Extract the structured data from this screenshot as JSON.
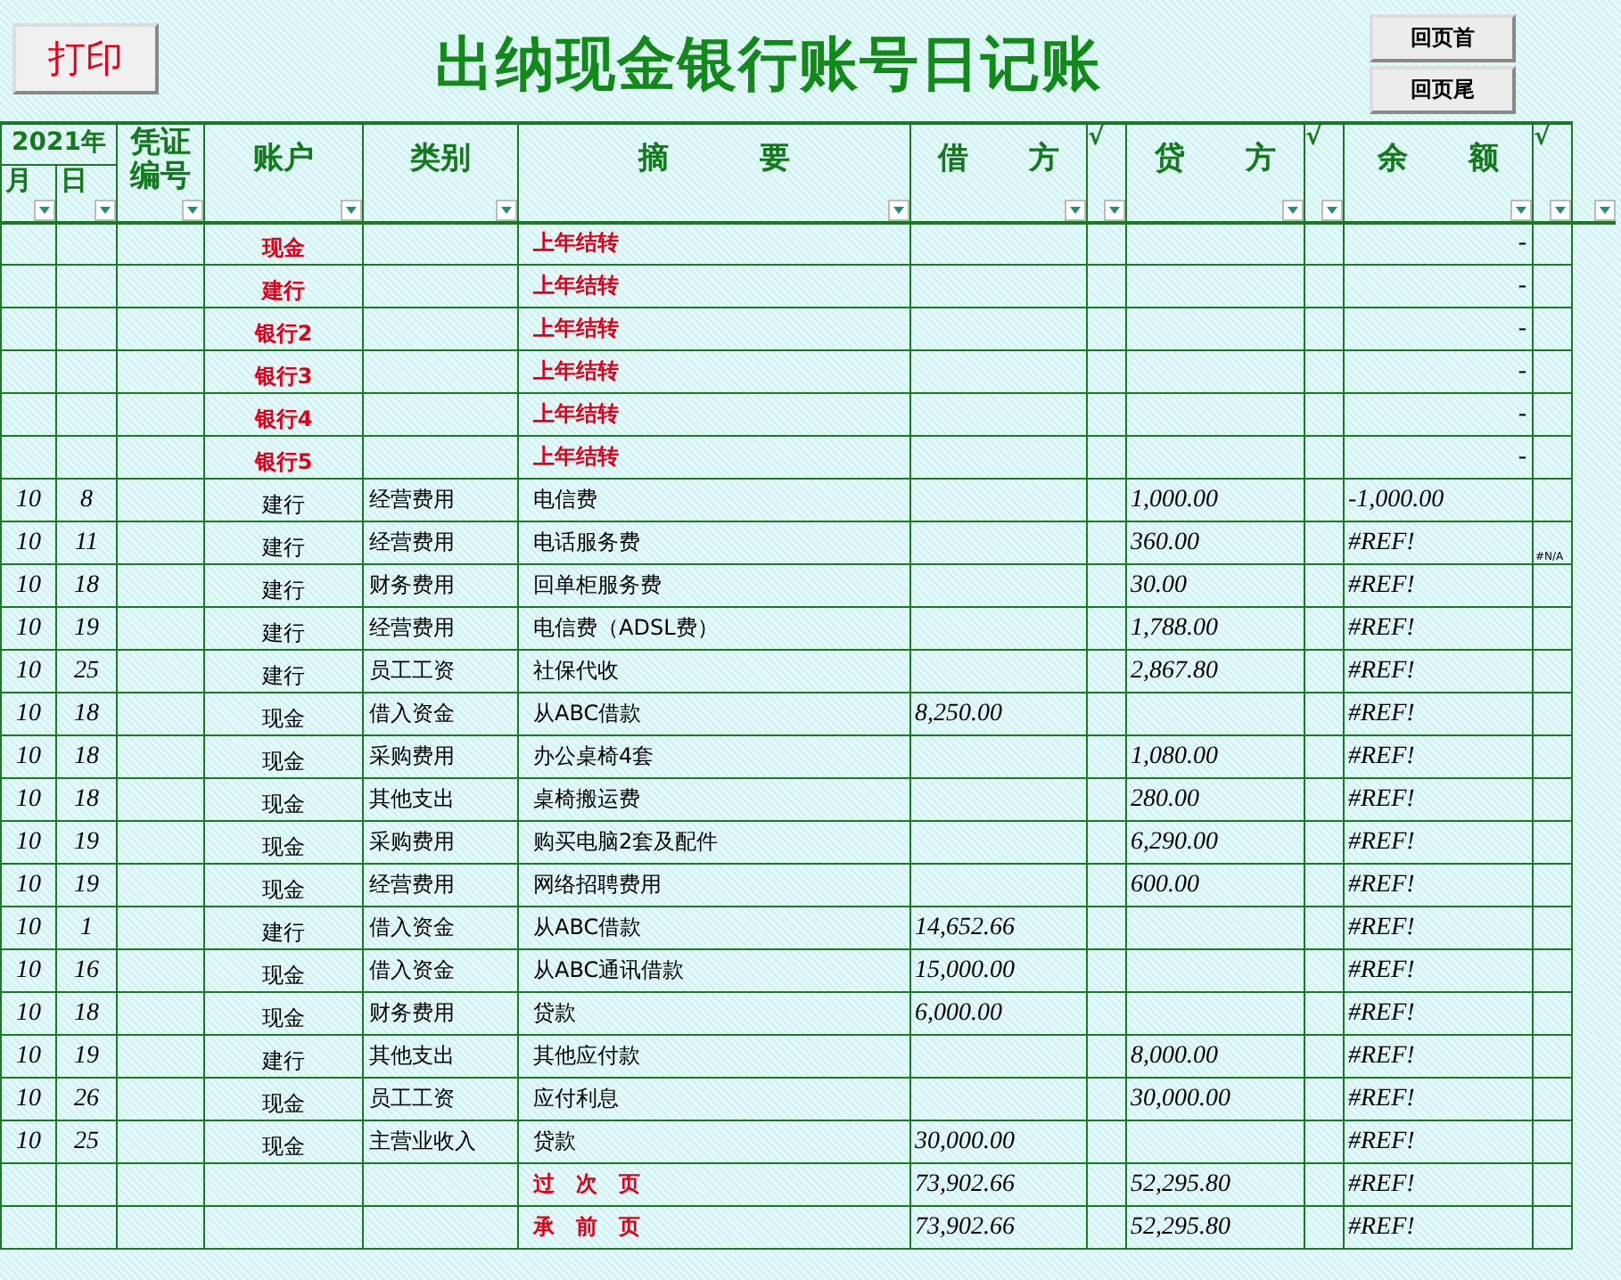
{
  "print_button": "打印",
  "title": "出纳现金银行账号日记账",
  "nav_buttons": [
    "回页首",
    "回页尾"
  ],
  "year_header": "2021年",
  "columns": [
    {
      "label": "月"
    },
    {
      "label": "日"
    },
    {
      "label": "凭证编号"
    },
    {
      "label": "账户"
    },
    {
      "label": "类别"
    },
    {
      "label": "摘　　　要"
    },
    {
      "label": "借　　方"
    },
    {
      "label": "√"
    },
    {
      "label": "贷　　方"
    },
    {
      "label": "√"
    },
    {
      "label": "余　　额"
    },
    {
      "label": "√"
    }
  ],
  "rows": [
    {
      "kind": "opening",
      "account": "现金",
      "summary": "上年结转",
      "balance": "-"
    },
    {
      "kind": "opening",
      "account": "建行",
      "summary": "上年结转",
      "balance": "-"
    },
    {
      "kind": "opening",
      "account": "银行2",
      "summary": "上年结转",
      "balance": "-"
    },
    {
      "kind": "opening",
      "account": "银行3",
      "summary": "上年结转",
      "balance": "-"
    },
    {
      "kind": "opening",
      "account": "银行4",
      "summary": "上年结转",
      "balance": "-"
    },
    {
      "kind": "opening",
      "account": "银行5",
      "summary": "上年结转",
      "balance": "-"
    },
    {
      "kind": "entry",
      "month": "10",
      "day": "8",
      "account": "建行",
      "category": "经营费用",
      "summary": "电信费",
      "credit": "1,000.00",
      "balance": "-1,000.00"
    },
    {
      "kind": "entry",
      "month": "10",
      "day": "11",
      "account": "建行",
      "category": "经营费用",
      "summary": "电话服务费",
      "credit": "360.00",
      "balance": "#REF!",
      "note": "#N/A"
    },
    {
      "kind": "entry",
      "month": "10",
      "day": "18",
      "account": "建行",
      "category": "财务费用",
      "summary": "回单柜服务费",
      "credit": "30.00",
      "balance": "#REF!"
    },
    {
      "kind": "entry",
      "month": "10",
      "day": "19",
      "account": "建行",
      "category": "经营费用",
      "summary": "电信费（ADSL费）",
      "credit": "1,788.00",
      "balance": "#REF!"
    },
    {
      "kind": "entry",
      "month": "10",
      "day": "25",
      "account": "建行",
      "category": "员工工资",
      "summary": "社保代收",
      "credit": "2,867.80",
      "balance": "#REF!"
    },
    {
      "kind": "entry",
      "month": "10",
      "day": "18",
      "account": "现金",
      "category": "借入资金",
      "summary": "从ABC借款",
      "debit": "8,250.00",
      "balance": "#REF!"
    },
    {
      "kind": "entry",
      "month": "10",
      "day": "18",
      "account": "现金",
      "category": "采购费用",
      "summary": "办公桌椅4套",
      "credit": "1,080.00",
      "balance": "#REF!"
    },
    {
      "kind": "entry",
      "month": "10",
      "day": "18",
      "account": "现金",
      "category": "其他支出",
      "summary": "桌椅搬运费",
      "credit": "280.00",
      "balance": "#REF!"
    },
    {
      "kind": "entry",
      "month": "10",
      "day": "19",
      "account": "现金",
      "category": "采购费用",
      "summary": "购买电脑2套及配件",
      "credit": "6,290.00",
      "balance": "#REF!"
    },
    {
      "kind": "entry",
      "month": "10",
      "day": "19",
      "account": "现金",
      "category": "经营费用",
      "summary": "网络招聘费用",
      "credit": "600.00",
      "balance": "#REF!"
    },
    {
      "kind": "entry",
      "month": "10",
      "day": "1",
      "account": "建行",
      "category": "借入资金",
      "summary": "从ABC借款",
      "debit": "14,652.66",
      "balance": "#REF!"
    },
    {
      "kind": "entry",
      "month": "10",
      "day": "16",
      "account": "现金",
      "category": "借入资金",
      "summary": "从ABC通讯借款",
      "debit": "15,000.00",
      "balance": "#REF!"
    },
    {
      "kind": "entry",
      "month": "10",
      "day": "18",
      "account": "现金",
      "category": "财务费用",
      "summary": "贷款",
      "debit": "6,000.00",
      "balance": "#REF!"
    },
    {
      "kind": "entry",
      "month": "10",
      "day": "19",
      "account": "建行",
      "category": "其他支出",
      "summary": "其他应付款",
      "credit": "8,000.00",
      "balance": "#REF!"
    },
    {
      "kind": "entry",
      "month": "10",
      "day": "26",
      "account": "现金",
      "category": "员工工资",
      "summary": "应付利息",
      "credit": "30,000.00",
      "balance": "#REF!"
    },
    {
      "kind": "entry",
      "month": "10",
      "day": "25",
      "account": "现金",
      "category": "主营业收入",
      "summary": "贷款",
      "debit": "30,000.00",
      "balance": "#REF!"
    },
    {
      "kind": "total",
      "summary": "过　次　页",
      "debit": "73,902.66",
      "credit": "52,295.80",
      "balance": "#REF!"
    },
    {
      "kind": "total",
      "summary": "承　前　页",
      "debit": "73,902.66",
      "credit": "52,295.80",
      "balance": "#REF!"
    }
  ]
}
